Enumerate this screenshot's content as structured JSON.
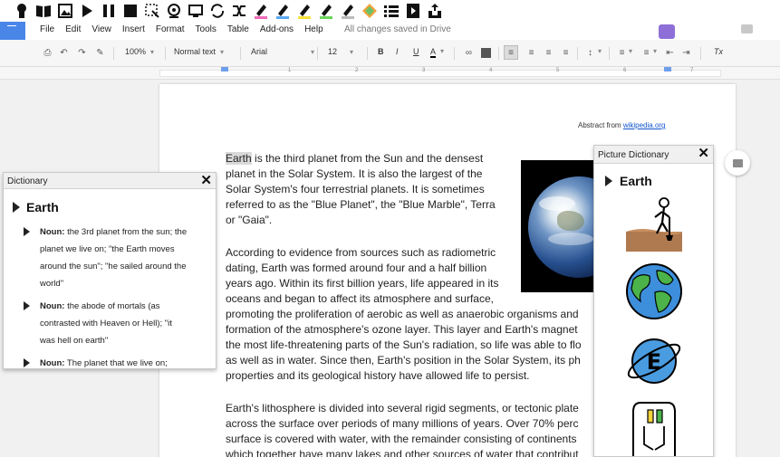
{
  "ext_toolbar": {
    "icons": [
      "speech-head-icon",
      "book-icon",
      "picture-icon",
      "play-icon",
      "pause-icon",
      "stop-icon",
      "screen-select-icon",
      "webcam-icon",
      "screen-mask-icon",
      "sync-icon",
      "shuffle-icon",
      "highlighter-pink-icon",
      "highlighter-blue-icon",
      "highlighter-yellow-icon",
      "highlighter-green-icon",
      "highlighter-clear-icon",
      "diamond-icon",
      "list-icon",
      "voice-note-icon",
      "share-icon"
    ]
  },
  "menu": {
    "items": [
      "File",
      "Edit",
      "View",
      "Insert",
      "Format",
      "Tools",
      "Table",
      "Add-ons",
      "Help"
    ],
    "save_status": "All changes saved in Drive"
  },
  "format_bar": {
    "zoom": "100%",
    "style": "Normal text",
    "font": "Arial",
    "size": "12",
    "bold": "B",
    "italic": "I",
    "underline": "U",
    "text_color": "A",
    "clear_format": "Tx"
  },
  "ruler": {
    "numbers": [
      "1",
      "2",
      "3",
      "4",
      "5",
      "6",
      "7"
    ]
  },
  "document": {
    "abstract_prefix": "Abstract from",
    "abstract_link": "wikipedia.org",
    "highlight_word": "Earth",
    "para1": [
      " is the third planet from the Sun and the densest",
      "planet in the Solar System. It is also the largest of the",
      "Solar System's four terrestrial planets. It is sometimes",
      "referred to as the \"Blue Planet\", the \"Blue Marble\", Terra",
      "or \"Gaia\"."
    ],
    "para2": [
      "According to evidence from sources such as radiometric",
      "dating, Earth was formed around four and a half billion",
      "years ago. Within its first billion years, life appeared in its",
      "oceans and began to affect its atmosphere and surface,",
      "promoting the proliferation of aerobic as well as anaerobic organisms and",
      "formation of the atmosphere's ozone layer. This layer and Earth's magnet",
      "the most life-threatening parts of the Sun's radiation, so life was able to flo",
      "as well as in water. Since then, Earth's position in the Solar System, its ph",
      "properties and its geological history have allowed life to persist."
    ],
    "para3": [
      "Earth's lithosphere is divided into several rigid segments, or tectonic plate",
      "across the surface over periods of many millions of years. Over 70% perc",
      "surface is covered with water, with the remainder consisting of continents",
      "which together have many lakes and other sources of water that contribut"
    ]
  },
  "dictionary": {
    "title": "Dictionary",
    "close": "✕",
    "word": "Earth",
    "definitions": [
      {
        "pos": "Noun:",
        "lines": [
          " the 3rd planet from the sun; the",
          "planet we live on; \"the Earth moves",
          "around the sun\"; \"he sailed around the",
          "world\""
        ]
      },
      {
        "pos": "Noun:",
        "lines": [
          " the abode of mortals (as",
          "contrasted with Heaven or Hell); \"it",
          "was hell on earth\""
        ]
      },
      {
        "pos": "Noun:",
        "lines": [
          " The planet that we live on;"
        ]
      }
    ]
  },
  "picture_dictionary": {
    "title": "Picture Dictionary",
    "close": "✕",
    "word": "Earth",
    "symbols": [
      "person-digging-soil-icon",
      "globe-icon",
      "earth-planet-icon",
      "electrical-socket-icon"
    ],
    "planet_letter": "E"
  },
  "colors": {
    "docs_blue": "#4a86e8",
    "link_blue": "#1155cc",
    "word_highlight": "#dadada",
    "toolbar_bg": "#f6f6f6",
    "canvas_bg": "#f1f1f1"
  }
}
